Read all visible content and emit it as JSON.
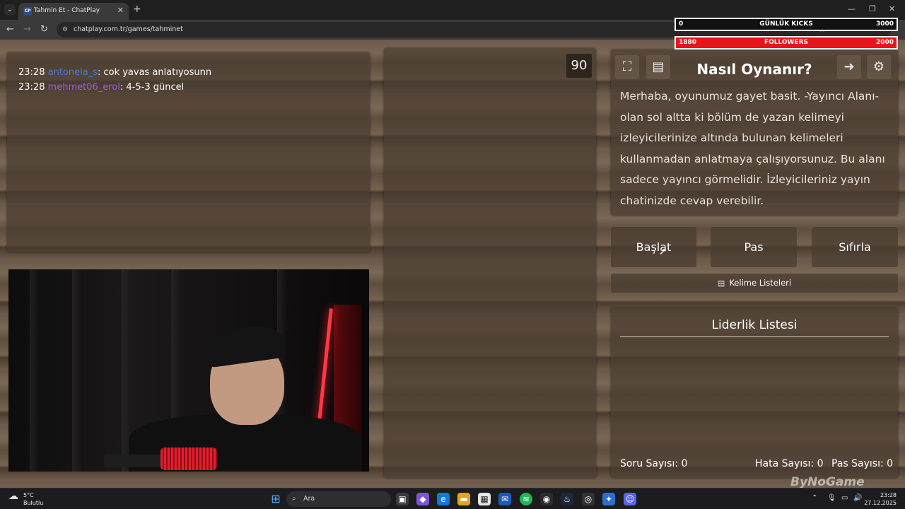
{
  "browser": {
    "tab_title": "Tahmin Et - ChatPlay",
    "tab_favicon": "CP",
    "url": "chatplay.com.tr/games/tahminet"
  },
  "overlay": {
    "kicks_left": "0",
    "kicks_label": "GÜNLÜK KICKS",
    "kicks_right": "3000",
    "followers_left": "1880",
    "followers_label": "FOLLOWERS",
    "followers_right": "2000"
  },
  "chat": {
    "messages": [
      {
        "time": "23:28",
        "user": "antonela_s",
        "text": ": cok yavas anlatıyosunn"
      },
      {
        "time": "23:28",
        "user": "mehmet06_erol",
        "text": ": 4-5-3 güncel"
      }
    ]
  },
  "game": {
    "timer": "90",
    "how_to_title": "Nasıl Oynanır?",
    "how_to_text": "Merhaba, oyunumuz gayet basit. -Yayıncı Alanı- olan sol altta ki bölüm de yazan kelimeyi izleyicilerinize altında bulunan kelimeleri kullanmadan anlatmaya çalışıyorsunuz. Bu alanı sadece yayıncı görmelidir. İzleyicileriniz yayın chatinizde cevap verebilir.",
    "buttons": {
      "start": "Başlat",
      "pass": "Pas",
      "reset": "Sıfırla"
    },
    "word_lists": "Kelime Listeleri",
    "leaderboard_title": "Liderlik Listesi",
    "stats": {
      "questions_label": "Soru Sayısı:",
      "questions_value": "0",
      "errors_label": "Hata Sayısı:",
      "errors_value": "0",
      "passes_label": "Pas Sayısı:",
      "passes_value": "0"
    }
  },
  "watermark": "ByNoGame",
  "taskbar": {
    "temperature": "5°C",
    "weather": "Bulutlu",
    "search_placeholder": "Ara",
    "time": "23:28",
    "date": "27.12.2025"
  },
  "colors": {
    "followers_bar": "#e8141c",
    "chat_user_1": "#4e78c9",
    "chat_user_2": "#9a5bd8"
  }
}
